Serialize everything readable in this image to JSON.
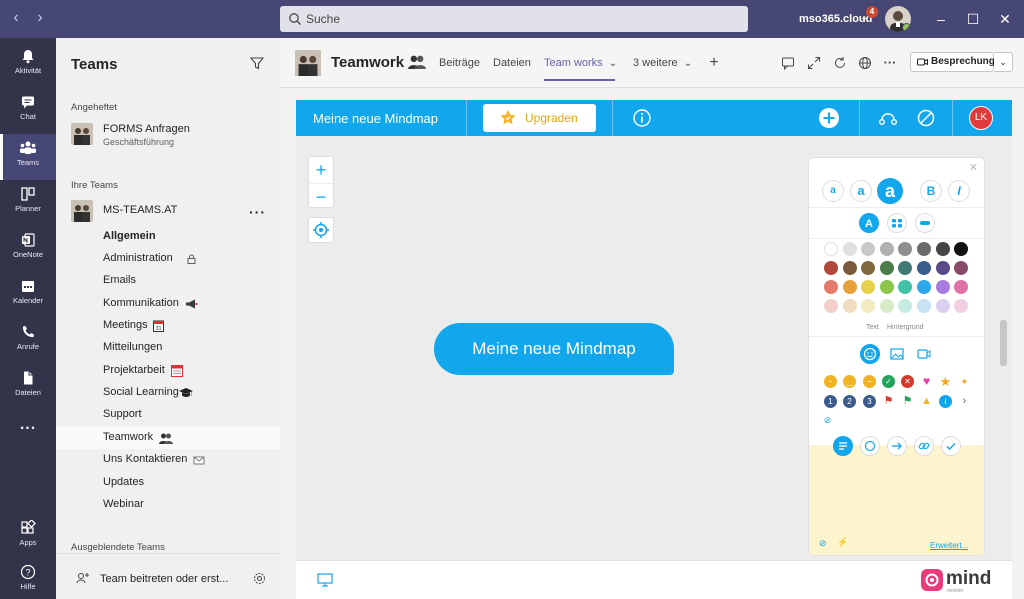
{
  "titlebar": {
    "search_placeholder": "Suche",
    "tenant": "mso365.cloud",
    "notification_count": "4"
  },
  "appbar": {
    "items": [
      {
        "label": "Aktivität"
      },
      {
        "label": "Chat"
      },
      {
        "label": "Teams"
      },
      {
        "label": "Planner"
      },
      {
        "label": "OneNote"
      },
      {
        "label": "Kalender"
      },
      {
        "label": "Anrufe"
      },
      {
        "label": "Dateien"
      },
      {
        "label": "..."
      }
    ],
    "apps_label": "Apps",
    "help_label": "Hilfe"
  },
  "teampanel": {
    "title": "Teams",
    "pinned_label": "Angeheftet",
    "pinned_team": {
      "name": "FORMS Anfragen",
      "sub": "Geschäftsführung"
    },
    "my_teams_label": "Ihre Teams",
    "team": {
      "name": "MS-TEAMS.AT"
    },
    "channels": [
      {
        "label": "Allgemein"
      },
      {
        "label": "Administration"
      },
      {
        "label": "Emails"
      },
      {
        "label": "Kommunikation"
      },
      {
        "label": "Meetings"
      },
      {
        "label": "Mitteilungen"
      },
      {
        "label": "Projektarbeit"
      },
      {
        "label": "Social Learning"
      },
      {
        "label": "Support"
      },
      {
        "label": "Teamwork"
      },
      {
        "label": "Uns Kontaktieren"
      },
      {
        "label": "Updates"
      },
      {
        "label": "Webinar"
      }
    ],
    "hidden_teams_label": "Ausgeblendete Teams",
    "join_label": "Team beitreten oder erst..."
  },
  "channel_header": {
    "title": "Teamwork",
    "tabs": [
      {
        "label": "Beiträge"
      },
      {
        "label": "Dateien"
      },
      {
        "label": "Team works"
      },
      {
        "label": "3 weitere"
      }
    ],
    "meeting_label": "Besprechung"
  },
  "mindmap": {
    "title": "Meine neue Mindmap",
    "upgrade_label": "Upgraden",
    "user_initials": "LK",
    "node_text": "Meine neue Mindmap",
    "text_label": "Text",
    "background_label": "Hintergrund",
    "more_label": "Erweitert...",
    "brand": "mind",
    "brand_sub": "meister"
  },
  "colors": {
    "accent": "#12a6ec",
    "teams_purple": "#464775",
    "app_bar": "#33344a",
    "upgrade_gold": "#e8a317",
    "avatar_red": "#e03a3a"
  }
}
